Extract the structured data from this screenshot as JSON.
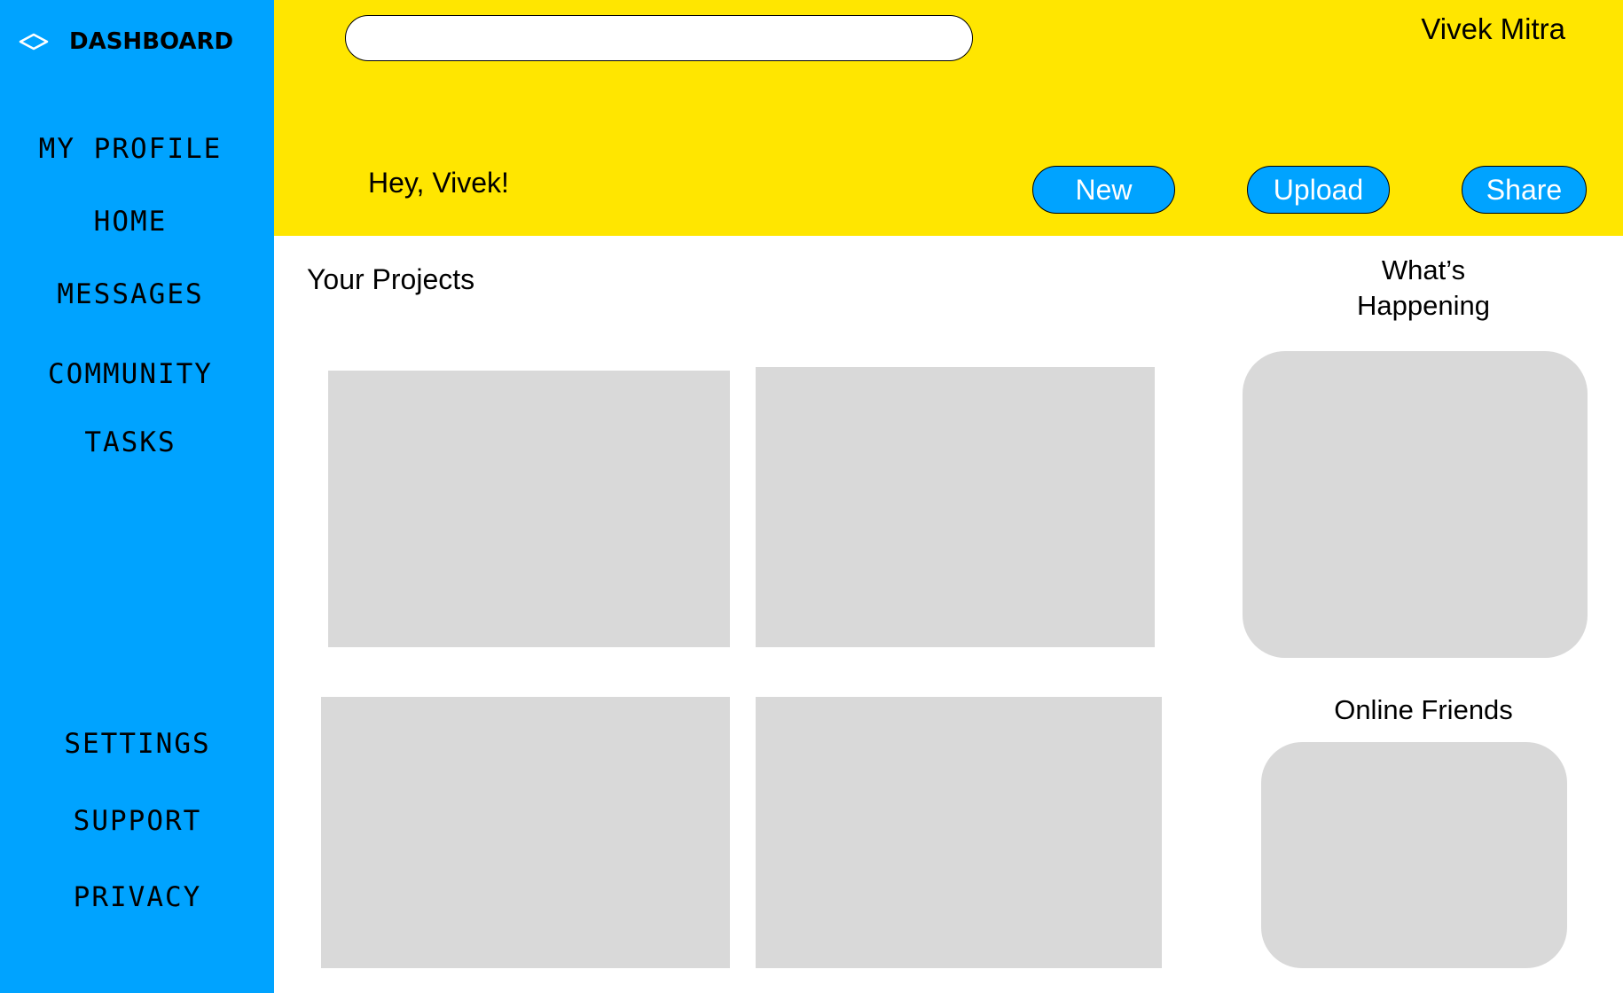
{
  "sidebar": {
    "brand": {
      "label": "DASHBOARD",
      "icon": "diamond-outline-icon"
    },
    "items": [
      {
        "label": "MY PROFILE"
      },
      {
        "label": "HOME"
      },
      {
        "label": "MESSAGES"
      },
      {
        "label": "COMMUNITY"
      },
      {
        "label": "TASKS"
      }
    ],
    "bottom_items": [
      {
        "label": "SETTINGS"
      },
      {
        "label": "SUPPORT"
      },
      {
        "label": "PRIVACY"
      }
    ]
  },
  "header": {
    "search": {
      "value": "",
      "placeholder": ""
    },
    "user_name": "Vivek Mitra",
    "greeting": "Hey, Vivek!",
    "buttons": {
      "new": "New",
      "upload": "Upload",
      "share": "Share"
    }
  },
  "main": {
    "projects_title": "Your Projects"
  },
  "right_panel": {
    "whats_happening_title": "What’s\nHappening",
    "online_friends_title": "Online Friends"
  },
  "colors": {
    "sidebar_bg": "#00a3ff",
    "header_bg": "#ffe600",
    "button_bg": "#00a3ff",
    "placeholder_gray": "#d9d9d9"
  }
}
